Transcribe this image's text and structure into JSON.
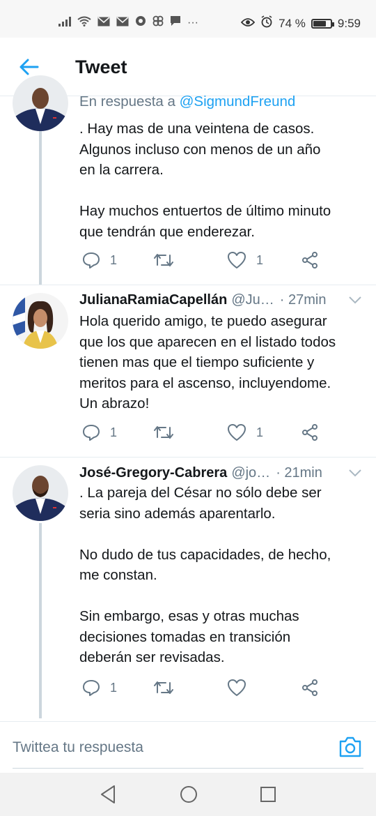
{
  "status_bar": {
    "battery": "74 %",
    "time": "9:59"
  },
  "header": {
    "title": "Tweet"
  },
  "first_tweet": {
    "reply_prefix": "En respuesta a",
    "reply_handle": "@SigmundFreund",
    "text": ". Hay mas de una veintena de casos.\nAlgunos incluso con menos de un año\nen la carrera.\n\nHay muchos entuertos de último minuto\nque tendrán que enderezar.",
    "replies": "1",
    "likes": "1"
  },
  "second_tweet": {
    "name": "JulianaRamiaCapellán",
    "username": "@Ju…",
    "time": "· 27min",
    "text": "Hola querido amigo, te puedo asegurar\nque los que aparecen en el listado todos\ntienen mas que el tiempo suficiente y\nmeritos para el ascenso, incluyendome.\nUn abrazo!",
    "replies": "1",
    "likes": "1"
  },
  "third_tweet": {
    "name": "José-Gregory-Cabrera",
    "username": "@jo…",
    "time": "· 21min",
    "text": ". La pareja del César no sólo debe ser\nseria sino además aparentarlo.\n\nNo dudo de tus capacidades, de hecho,\nme constan.\n\nSin embargo, esas y otras muchas\ndecisiones tomadas en transición\ndeberán ser revisadas.",
    "replies": "1",
    "likes": ""
  },
  "compose": {
    "placeholder": "Twittea tu respuesta"
  },
  "colors": {
    "accent": "#1da1f2",
    "secondary_text": "#657786",
    "thread_line": "#ccd6dd"
  }
}
